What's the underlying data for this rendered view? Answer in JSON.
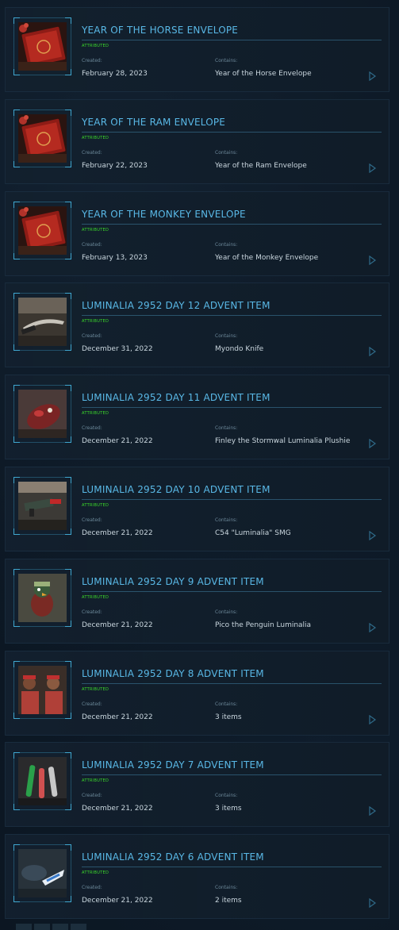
{
  "items": [
    {
      "title": "YEAR OF THE HORSE ENVELOPE",
      "badge": "ATTRIBUTED",
      "created_label": "Created:",
      "created": "February 28, 2023",
      "contains_label": "Contains:",
      "contains": "Year of the Horse Envelope",
      "thumb": "red-envelope"
    },
    {
      "title": "YEAR OF THE RAM ENVELOPE",
      "badge": "ATTRIBUTED",
      "created_label": "Created:",
      "created": "February 22, 2023",
      "contains_label": "Contains:",
      "contains": "Year of the Ram Envelope",
      "thumb": "red-envelope"
    },
    {
      "title": "YEAR OF THE MONKEY ENVELOPE",
      "badge": "ATTRIBUTED",
      "created_label": "Created:",
      "created": "February 13, 2023",
      "contains_label": "Contains:",
      "contains": "Year of the Monkey Envelope",
      "thumb": "red-envelope"
    },
    {
      "title": "LUMINALIA 2952 DAY 12 ADVENT ITEM",
      "badge": "ATTRIBUTED",
      "created_label": "Created:",
      "created": "December 31, 2022",
      "contains_label": "Contains:",
      "contains": "Myondo Knife",
      "thumb": "knife"
    },
    {
      "title": "LUMINALIA 2952 DAY 11 ADVENT ITEM",
      "badge": "ATTRIBUTED",
      "created_label": "Created:",
      "created": "December 21, 2022",
      "contains_label": "Contains:",
      "contains": "Finley the Stormwal Luminalia Plushie",
      "thumb": "plushie"
    },
    {
      "title": "LUMINALIA 2952 DAY 10 ADVENT ITEM",
      "badge": "ATTRIBUTED",
      "created_label": "Created:",
      "created": "December 21, 2022",
      "contains_label": "Contains:",
      "contains": "C54 \"Luminalia\" SMG",
      "thumb": "smg"
    },
    {
      "title": "LUMINALIA 2952 DAY 9 ADVENT ITEM",
      "badge": "ATTRIBUTED",
      "created_label": "Created:",
      "created": "December 21, 2022",
      "contains_label": "Contains:",
      "contains": "Pico the Penguin Luminalia",
      "thumb": "penguin"
    },
    {
      "title": "LUMINALIA 2952 DAY 8 ADVENT ITEM",
      "badge": "ATTRIBUTED",
      "created_label": "Created:",
      "created": "December 21, 2022",
      "contains_label": "Contains:",
      "contains": "3 items",
      "thumb": "people"
    },
    {
      "title": "LUMINALIA 2952 DAY 7 ADVENT ITEM",
      "badge": "ATTRIBUTED",
      "created_label": "Created:",
      "created": "December 21, 2022",
      "contains_label": "Contains:",
      "contains": "3 items",
      "thumb": "bottles"
    },
    {
      "title": "LUMINALIA 2952 DAY 6 ADVENT ITEM",
      "badge": "ATTRIBUTED",
      "created_label": "Created:",
      "created": "December 21, 2022",
      "contains_label": "Contains:",
      "contains": "2 items",
      "thumb": "gear"
    }
  ]
}
